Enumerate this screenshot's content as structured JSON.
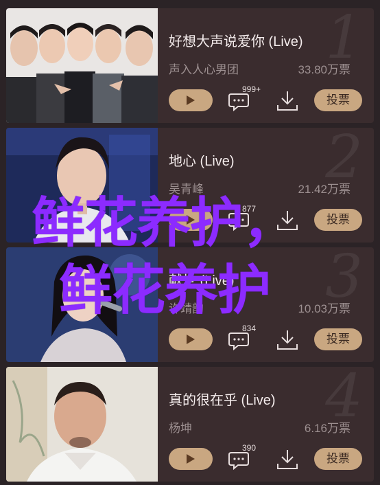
{
  "songs": [
    {
      "rank": "1",
      "title": "好想大声说爱你 (Live)",
      "artist": "声入人心男团",
      "votes": "33.80万票",
      "comments": "999+",
      "vote_label": "投票"
    },
    {
      "rank": "2",
      "title": "地心 (Live)",
      "artist": "吴青峰",
      "votes": "21.42万票",
      "comments": "877",
      "vote_label": "投票"
    },
    {
      "rank": "3",
      "title": "献世 (Live)",
      "artist": "许靖韵",
      "votes": "10.03万票",
      "comments": "834",
      "vote_label": "投票"
    },
    {
      "rank": "4",
      "title": "真的很在乎 (Live)",
      "artist": "杨坤",
      "votes": "6.16万票",
      "comments": "390",
      "vote_label": "投票"
    }
  ],
  "watermark": {
    "line1": "鲜花养护，",
    "line2": "鲜花养护"
  },
  "colors": {
    "accent": "#c9a781",
    "card_bg": "#3a2c2e",
    "page_bg": "#2b2326",
    "watermark": "#8c2bff"
  },
  "icons": [
    "play-icon",
    "comment-icon",
    "download-icon"
  ]
}
